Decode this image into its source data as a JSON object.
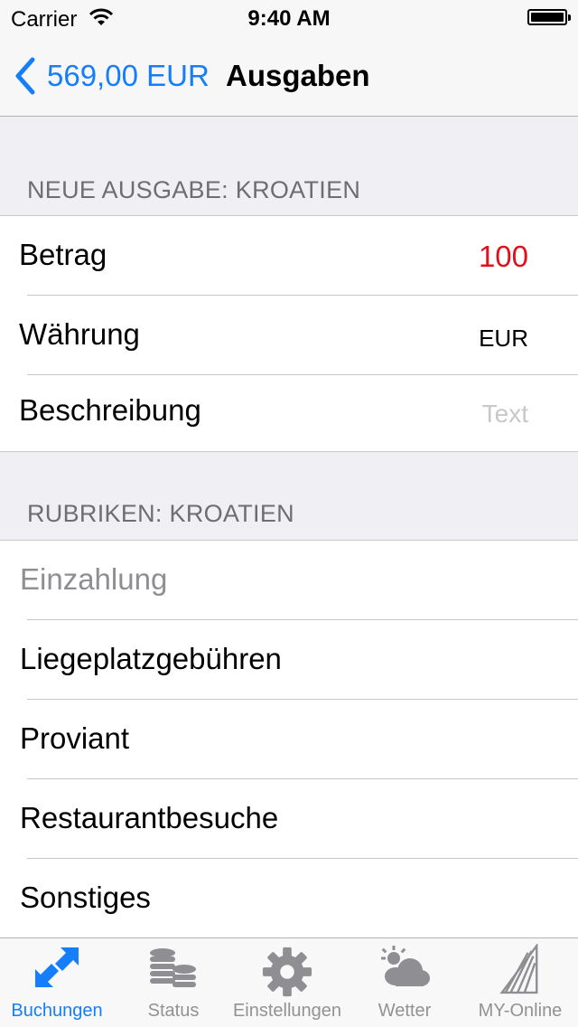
{
  "status_bar": {
    "carrier": "Carrier",
    "time": "9:40 AM"
  },
  "nav": {
    "back_label": "569,00 EUR",
    "title": "Ausgaben"
  },
  "sections": {
    "new_expense_header": "NEUE AUSGABE: KROATIEN",
    "categories_header": "RUBRIKEN: KROATIEN"
  },
  "form": {
    "amount_label": "Betrag",
    "amount_value": "100",
    "currency_label": "Währung",
    "currency_value": "EUR",
    "description_label": "Beschreibung",
    "description_placeholder": "Text"
  },
  "categories": [
    "Einzahlung",
    "Liegeplatzgebühren",
    "Proviant",
    "Restaurantbesuche",
    "Sonstiges"
  ],
  "tabs": [
    {
      "label": "Buchungen",
      "icon": "transfer-arrows-icon",
      "active": true
    },
    {
      "label": "Status",
      "icon": "coins-stack-icon",
      "active": false
    },
    {
      "label": "Einstellungen",
      "icon": "gear-icon",
      "active": false
    },
    {
      "label": "Wetter",
      "icon": "weather-cloud-icon",
      "active": false
    },
    {
      "label": "MY-Online",
      "icon": "sail-icon",
      "active": false
    }
  ],
  "colors": {
    "accent": "#157efb",
    "amount": "#e0101c",
    "section_text": "#6d6d72",
    "background": "#efeff4"
  }
}
